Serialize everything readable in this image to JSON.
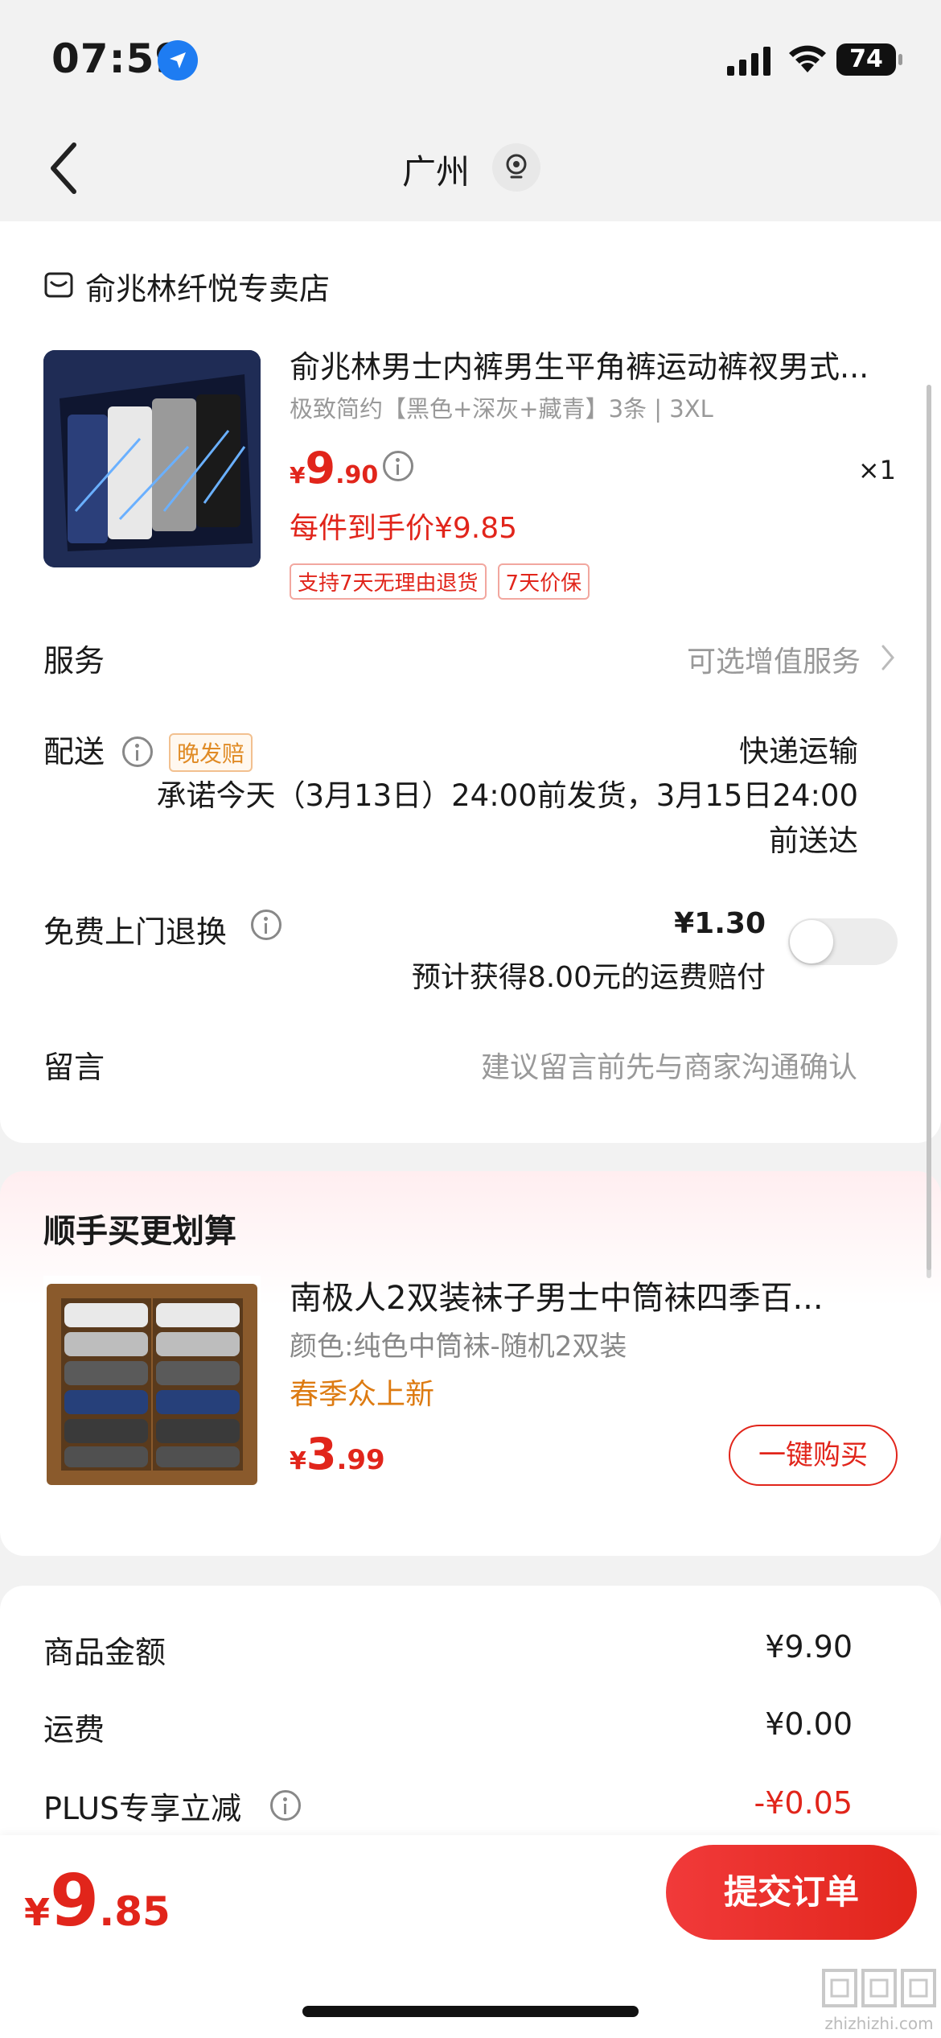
{
  "status_bar": {
    "time": "07:59",
    "battery": "74"
  },
  "nav": {
    "title": "广州"
  },
  "store": {
    "name": "俞兆林纤悦专卖店"
  },
  "product": {
    "title": "俞兆林男士内裤男生平角裤运动裤衩男式...",
    "spec": "极致简约【黑色+深灰+藏青】3条 | 3XL",
    "price_currency": "¥",
    "price_int": "9",
    "price_dec": ".90",
    "qty": "×1",
    "unit_price": "每件到手价¥9.85",
    "tags": [
      "支持7天无理由退货",
      "7天价保"
    ]
  },
  "service": {
    "label": "服务",
    "value": "可选增值服务"
  },
  "delivery": {
    "label": "配送",
    "badge": "晚发赔",
    "method": "快递运输",
    "desc": "承诺今天（3月13日）24:00前发货，3月15日24:00前送达"
  },
  "free_return": {
    "label": "免费上门退换",
    "fee": "¥1.30",
    "desc": "预计获得8.00元的运费赔付",
    "enabled": false
  },
  "note": {
    "label": "留言",
    "placeholder": "建议留言前先与商家沟通确认"
  },
  "recommend": {
    "title": "顺手买更划算",
    "item_title": "南极人2双装袜子男士中筒袜四季百...",
    "item_spec": "颜色:纯色中筒袜-随机2双装",
    "item_tag": "春季众上新",
    "price_currency": "¥",
    "price_int": "3",
    "price_dec": ".99",
    "buy_label": "一键购买"
  },
  "summary": [
    {
      "label": "商品金额",
      "value": "¥9.90"
    },
    {
      "label": "运费",
      "value": "¥0.00"
    },
    {
      "label": "PLUS专享立减",
      "value": "-¥0.05"
    }
  ],
  "bottom": {
    "total_currency": "¥",
    "total_int": "9",
    "total_dec": ".85",
    "submit_label": "提交订单"
  },
  "watermark": {
    "text": "zhizhizhi.com"
  },
  "colors": {
    "accent": "#e1251b",
    "orange": "#dd7b12",
    "gray": "#999999"
  }
}
